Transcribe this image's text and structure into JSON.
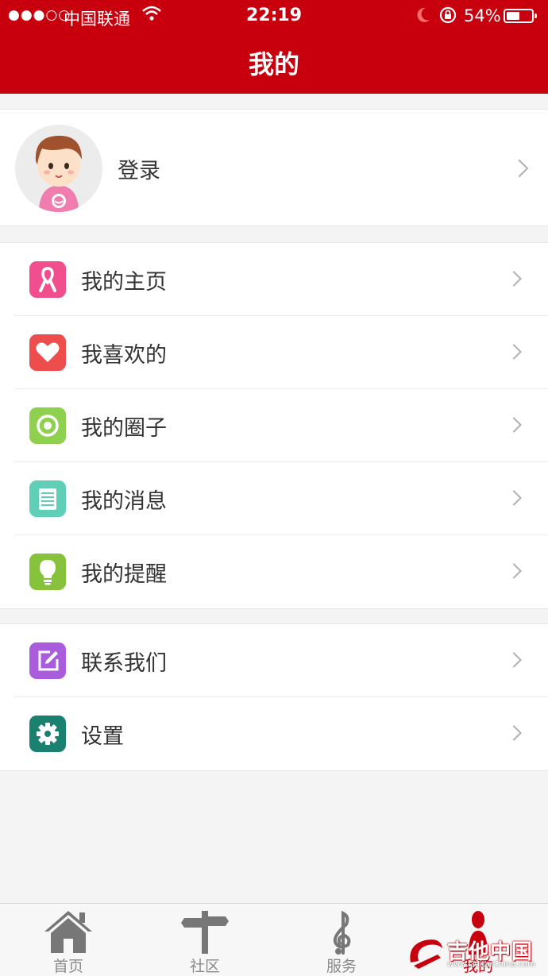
{
  "status_bar": {
    "signal": "●●●○○",
    "carrier": "中国联通",
    "time": "22:19",
    "battery_percent": "54%",
    "battery_level": 0.54
  },
  "header": {
    "title": "我的"
  },
  "login": {
    "label": "登录"
  },
  "menu_group_1": [
    {
      "label": "我的主页",
      "icon": "ribbon-icon",
      "color": "#f04e8c"
    },
    {
      "label": "我喜欢的",
      "icon": "heart-icon",
      "color": "#ee4d4d"
    },
    {
      "label": "我的圈子",
      "icon": "target-icon",
      "color": "#8fd14f"
    },
    {
      "label": "我的消息",
      "icon": "notepad-icon",
      "color": "#5fcfb8"
    },
    {
      "label": "我的提醒",
      "icon": "lightbulb-icon",
      "color": "#86c23c"
    }
  ],
  "menu_group_2": [
    {
      "label": "联系我们",
      "icon": "edit-icon",
      "color": "#a95ddc"
    },
    {
      "label": "设置",
      "icon": "gear-icon",
      "color": "#1a8070"
    }
  ],
  "tabbar": {
    "items": [
      {
        "label": "首页",
        "icon": "house-icon"
      },
      {
        "label": "社区",
        "icon": "signpost-icon"
      },
      {
        "label": "服务",
        "icon": "treble-clef-icon"
      },
      {
        "label": "我的",
        "icon": "person-icon"
      }
    ],
    "active_index": 3
  },
  "watermark": {
    "text": "吉他中国",
    "url": "www.GuitarChina.com"
  },
  "colors": {
    "brand": "#c8000e",
    "background": "#f4f4f4"
  }
}
